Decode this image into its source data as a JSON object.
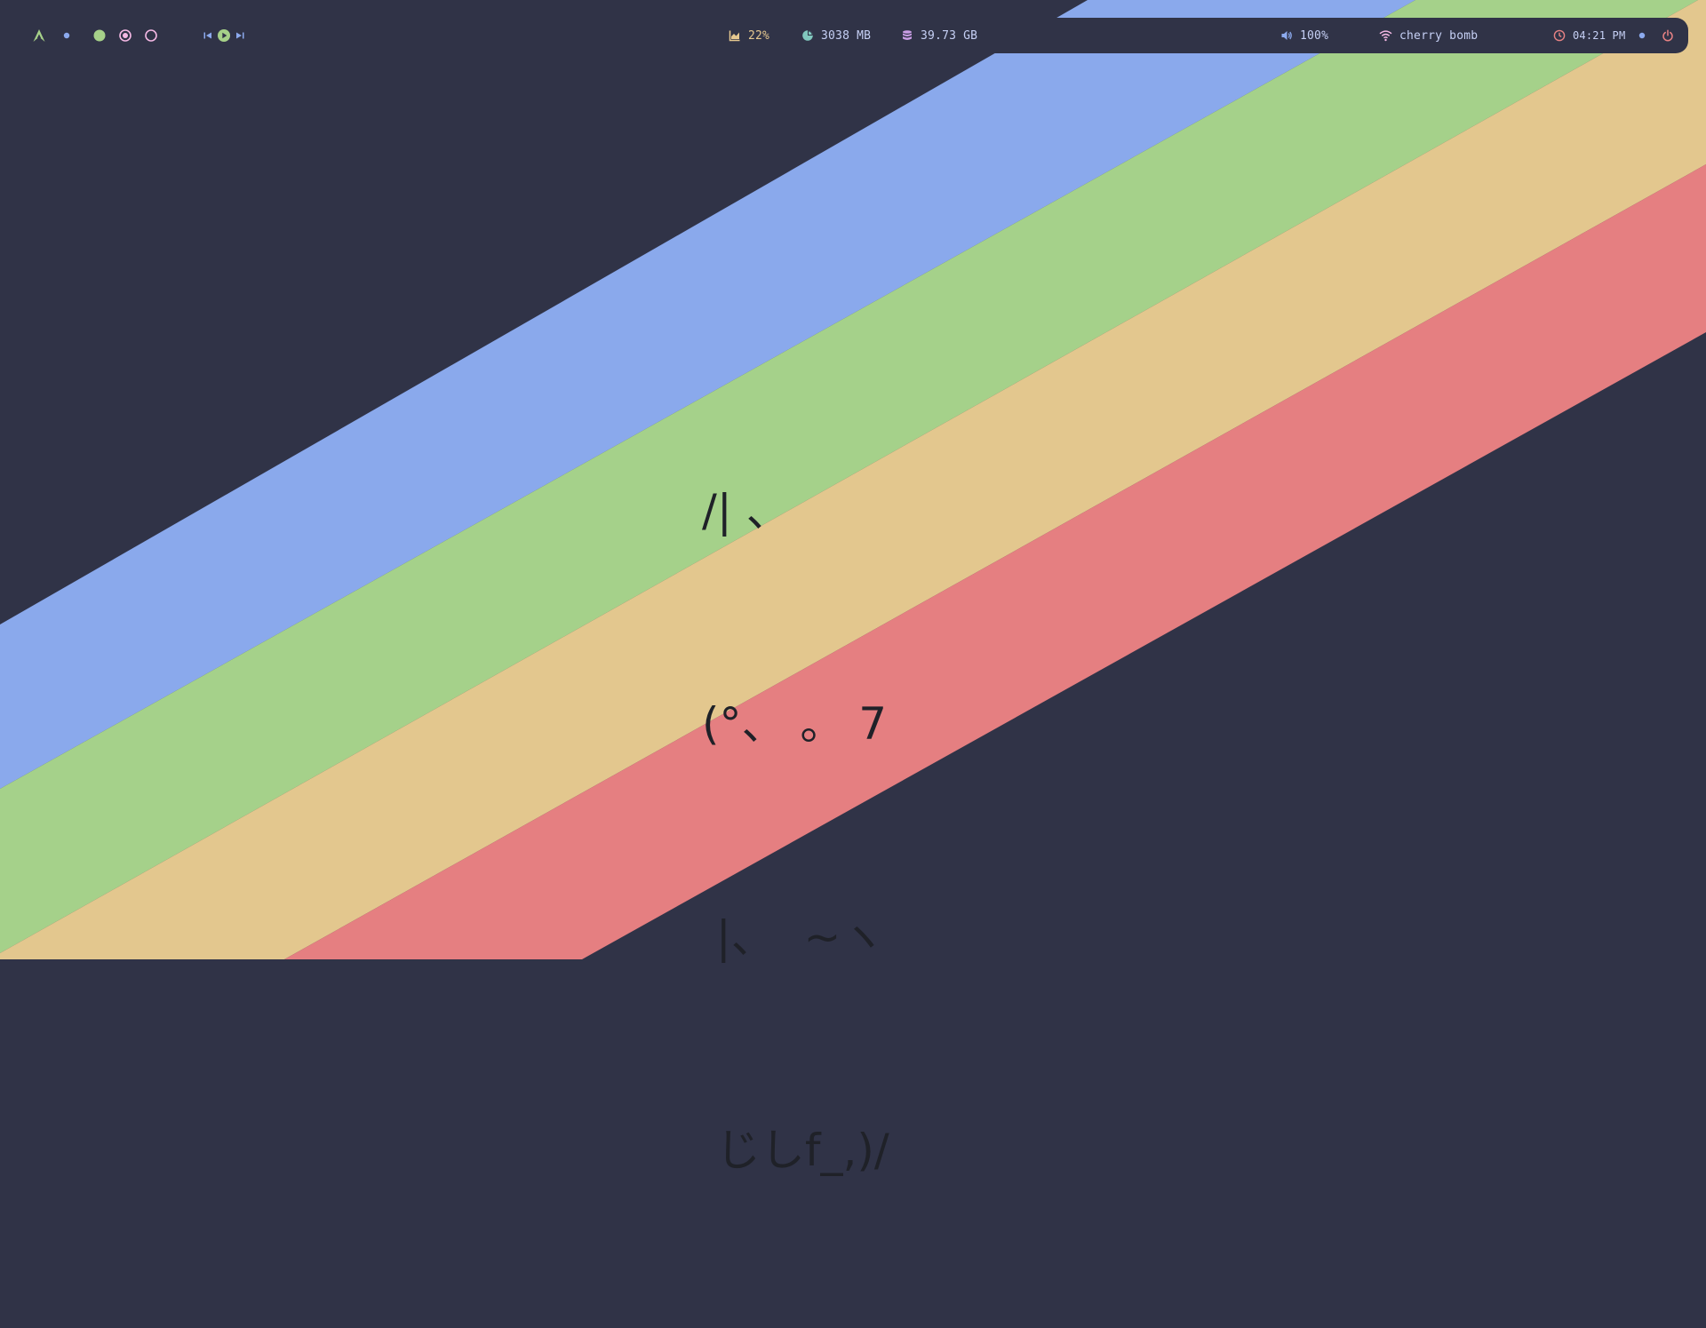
{
  "colors": {
    "background": "#303347",
    "stripe_blue": "#8aa9ec",
    "stripe_green": "#a5d18a",
    "stripe_yellow": "#e3c78e",
    "stripe_red": "#e57f81",
    "bar_bg": "#303347",
    "accent_green": "#a6d189",
    "accent_blue": "#8caaee",
    "accent_pink": "#f4b8e4",
    "accent_yellow": "#e5c890",
    "accent_red": "#e78284",
    "text": "#c6d0f5"
  },
  "workspaces": [
    {
      "state": "occupied",
      "color": "#a6d189"
    },
    {
      "state": "active",
      "color": "#f4b8e4"
    },
    {
      "state": "empty",
      "color": "#f4b8e4"
    }
  ],
  "media": {
    "prev_icon": "skip-back-icon",
    "play_icon": "play-icon",
    "next_icon": "skip-forward-icon"
  },
  "stats": {
    "cpu": "22%",
    "memory": "3038 MB",
    "disk": "39.73 GB"
  },
  "volume": "100%",
  "wifi": "cherry bomb",
  "clock": "04:21 PM",
  "ascii_art": [
    "/| 、",
    "(°、 。 7",
    " |、  ~ヽ",
    " じしf_,)/"
  ]
}
